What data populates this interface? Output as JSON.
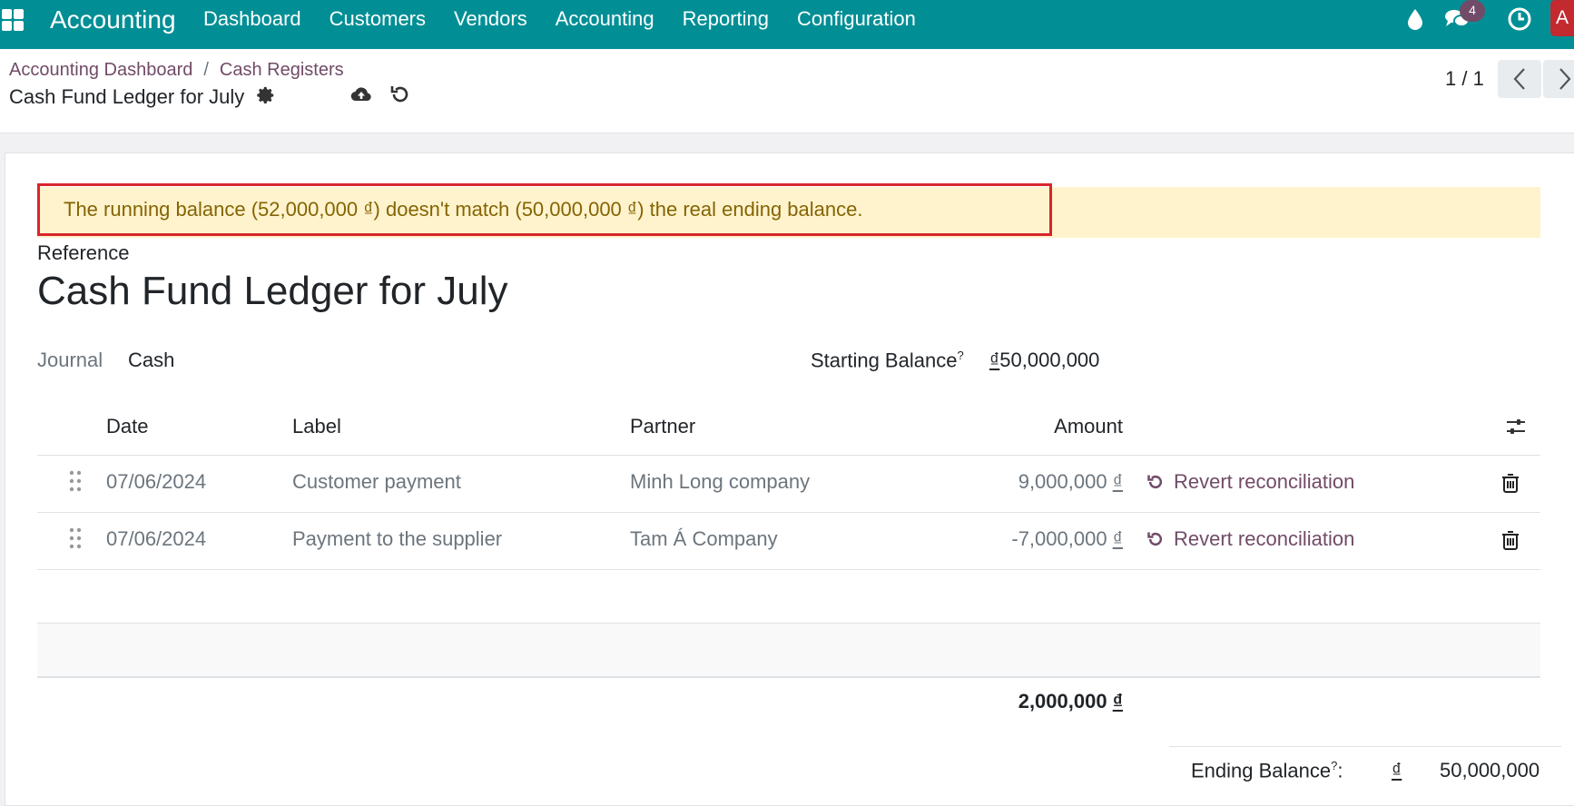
{
  "navbar": {
    "brand": "Accounting",
    "menu": [
      "Dashboard",
      "Customers",
      "Vendors",
      "Accounting",
      "Reporting",
      "Configuration"
    ],
    "messages_badge": "4",
    "avatar_letter": "A",
    "accent_color": "#018f95"
  },
  "breadcrumb": {
    "items": [
      "Accounting Dashboard",
      "Cash Registers"
    ],
    "current": "Cash Fund Ledger for July"
  },
  "pager": {
    "value": "1 / 1"
  },
  "alert": {
    "message": "The running balance (52,000,000 ₫) doesn't match (50,000,000 ₫) the real ending balance."
  },
  "form": {
    "reference_label": "Reference",
    "reference_value": "Cash Fund Ledger for July",
    "journal_label": "Journal",
    "journal_value": "Cash",
    "starting_balance_label": "Starting Balance",
    "help_mark": "?",
    "starting_balance_currency": "₫",
    "starting_balance_value": "50,000,000"
  },
  "table": {
    "columns": [
      "Date",
      "Label",
      "Partner",
      "Amount"
    ],
    "rows": [
      {
        "date": "07/06/2024",
        "label": "Customer payment",
        "partner": "Minh Long company",
        "amount": "9,000,000",
        "currency": "₫",
        "action": "Revert reconciliation"
      },
      {
        "date": "07/06/2024",
        "label": "Payment to the supplier",
        "partner": "Tam Á Company",
        "amount": "-7,000,000",
        "currency": "₫",
        "action": "Revert reconciliation"
      }
    ],
    "total": "2,000,000",
    "total_currency": "₫"
  },
  "ending": {
    "label": "Ending Balance",
    "help_mark": "?",
    "suffix": ":",
    "currency": "₫",
    "value": "50,000,000"
  }
}
